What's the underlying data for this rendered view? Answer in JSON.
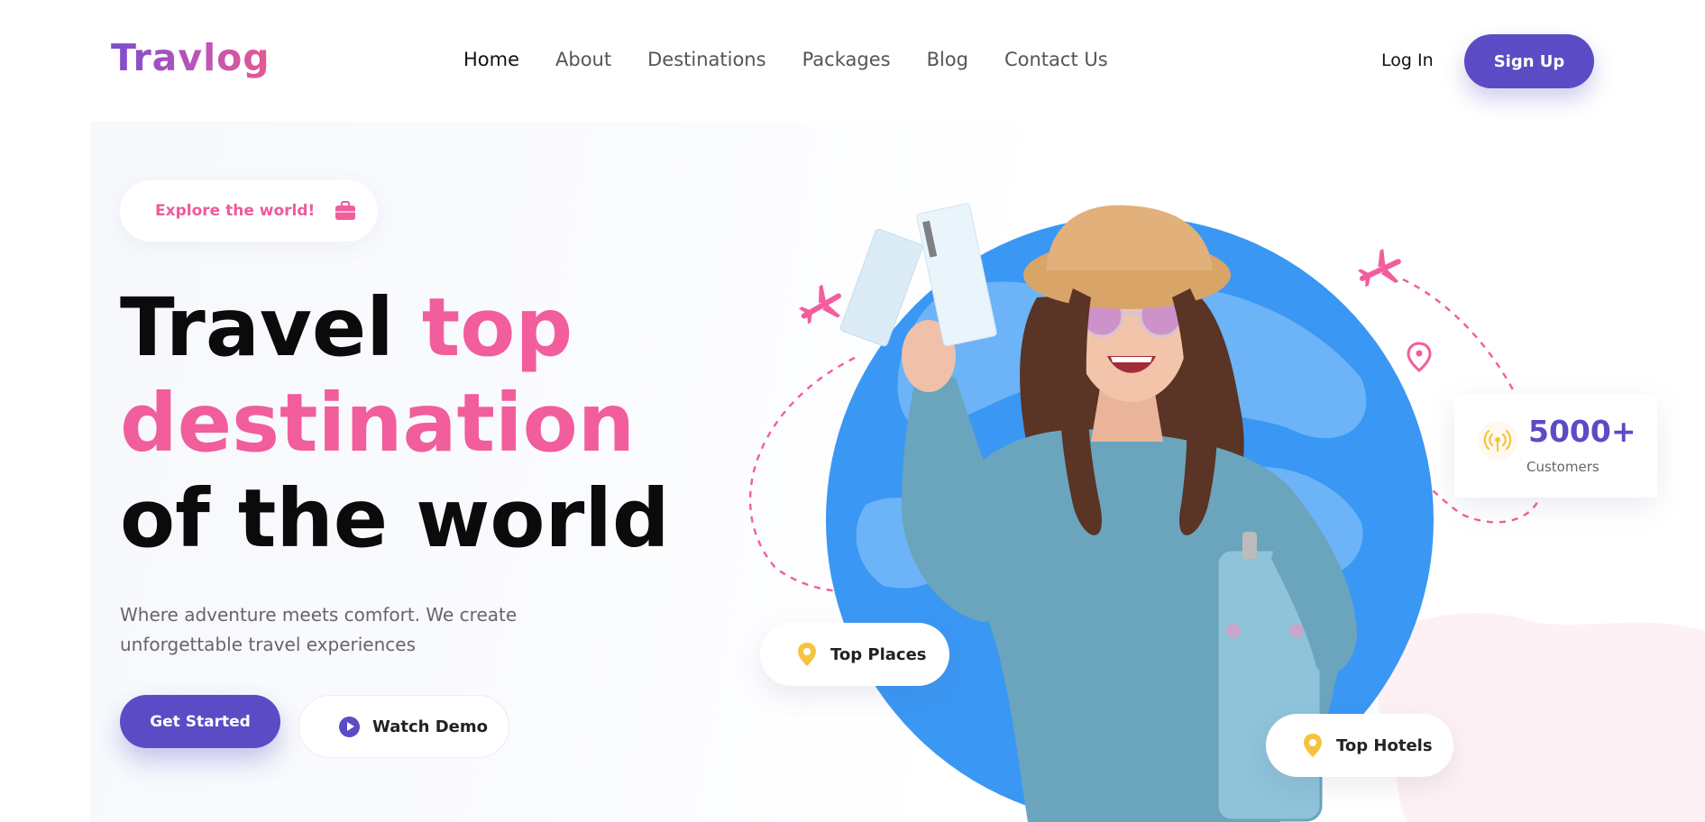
{
  "brand": {
    "logo": "Travlog"
  },
  "nav": {
    "items": [
      {
        "label": "Home"
      },
      {
        "label": "About"
      },
      {
        "label": "Destinations"
      },
      {
        "label": "Packages"
      },
      {
        "label": "Blog"
      },
      {
        "label": "Contact Us"
      }
    ],
    "active": "Home"
  },
  "auth": {
    "login_label": "Log In",
    "signup_label": "Sign Up"
  },
  "hero": {
    "tagline": "Explore the world!",
    "title_line1_plain": "Travel ",
    "title_line1_accent": "top",
    "title_line2_accent": "destination",
    "title_line3_plain": "of the world",
    "subtitle": "Where adventure meets comfort. We create unforgettable travel experiences",
    "cta_primary": "Get Started",
    "cta_secondary": "Watch Demo"
  },
  "badges": {
    "top_places": "Top Places",
    "top_hotels": "Top Hotels"
  },
  "stats": {
    "customers_value": "5000+",
    "customers_label": "Customers"
  },
  "colors": {
    "primary": "#5b4cc5",
    "accent_pink": "#f25d9c",
    "globe_blue": "#3a97f4",
    "pin_yellow": "#f6c340"
  }
}
